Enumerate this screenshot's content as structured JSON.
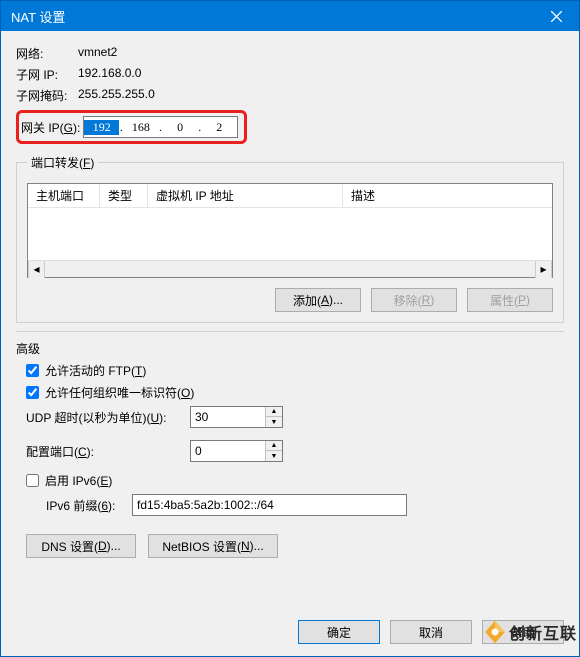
{
  "title": "NAT 设置",
  "info": {
    "network_label": "网络:",
    "network_value": "vmnet2",
    "subnet_ip_label": "子网 IP:",
    "subnet_ip_value": "192.168.0.0",
    "subnet_mask_label": "子网掩码:",
    "subnet_mask_value": "255.255.255.0",
    "gateway_label_prefix": "网关 IP(",
    "gateway_label_hotkey": "G",
    "gateway_label_suffix": "):",
    "gateway_octets": [
      "192",
      "168",
      "0",
      "2"
    ]
  },
  "port_forward": {
    "legend_prefix": "端口转发(",
    "legend_hotkey": "F",
    "legend_suffix": ")",
    "columns": {
      "host_port": "主机端口",
      "type": "类型",
      "vm_ip": "虚拟机 IP 地址",
      "desc": "描述"
    },
    "buttons": {
      "add_prefix": "添加(",
      "add_hotkey": "A",
      "add_suffix": ")...",
      "remove_prefix": "移除(",
      "remove_hotkey": "R",
      "remove_suffix": ")",
      "props_prefix": "属性(",
      "props_hotkey": "P",
      "props_suffix": ")"
    }
  },
  "advanced": {
    "title": "高级",
    "ftp_prefix": "允许活动的 FTP(",
    "ftp_hotkey": "T",
    "ftp_suffix": ")",
    "ftp_checked": true,
    "oui_prefix": "允许任何组织唯一标识符(",
    "oui_hotkey": "O",
    "oui_suffix": ")",
    "oui_checked": true,
    "udp_prefix": "UDP 超时(以秒为单位)(",
    "udp_hotkey": "U",
    "udp_suffix": "):",
    "udp_value": "30",
    "cfgport_prefix": "配置端口(",
    "cfgport_hotkey": "C",
    "cfgport_suffix": "):",
    "cfgport_value": "0",
    "ipv6_prefix": "启用 IPv6(",
    "ipv6_hotkey": "E",
    "ipv6_suffix": ")",
    "ipv6_checked": false,
    "ipv6prefix_prefix": "IPv6 前缀(",
    "ipv6prefix_hotkey": "6",
    "ipv6prefix_suffix": "):",
    "ipv6prefix_value": "fd15:4ba5:5a2b:1002::/64",
    "dns_prefix": "DNS 设置(",
    "dns_hotkey": "D",
    "dns_suffix": ")...",
    "netbios_prefix": "NetBIOS 设置(",
    "netbios_hotkey": "N",
    "netbios_suffix": ")..."
  },
  "footer": {
    "ok": "确定",
    "cancel": "取消",
    "help": "帮助"
  },
  "watermark": {
    "text": "创新互联"
  }
}
